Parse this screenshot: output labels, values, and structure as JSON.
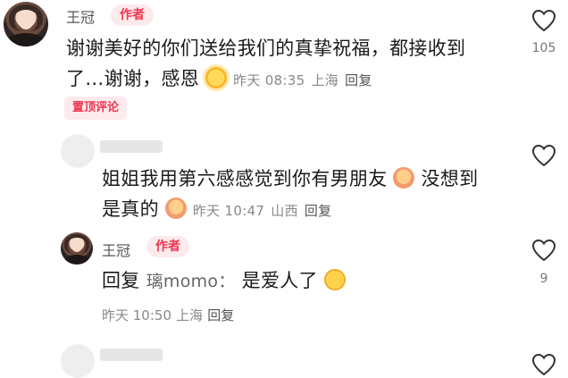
{
  "comments": [
    {
      "user": "王冠",
      "badge": "作者",
      "text_line1": "谢谢美好的你们送给我们的真挚祝福，都接收到",
      "text_line2": "了…谢谢，感恩",
      "emoji": "sun-icon",
      "time": "昨天 08:35",
      "location": "上海",
      "reply": "回复",
      "pinned_badge": "置顶评论",
      "likes": "105"
    },
    {
      "text_line1": "姐姐我用第六感感觉到你有男朋友",
      "text_line1b": "没想到",
      "text_line2": "是真的",
      "emoji1": "blush-face-icon",
      "emoji2": "peach-face-icon",
      "time": "昨天 10:47",
      "location": "山西",
      "reply": "回复"
    },
    {
      "user": "王冠",
      "badge": "作者",
      "reply_prefix": "回复",
      "reply_to": "璃momo：",
      "text": "是爱人了",
      "emoji": "smile-icon",
      "time": "昨天 10:50",
      "location": "上海",
      "reply": "回复",
      "likes": "9"
    }
  ],
  "colors": {
    "accent": "#f0344f",
    "badge_bg": "#fdeaec",
    "meta": "#888888"
  }
}
